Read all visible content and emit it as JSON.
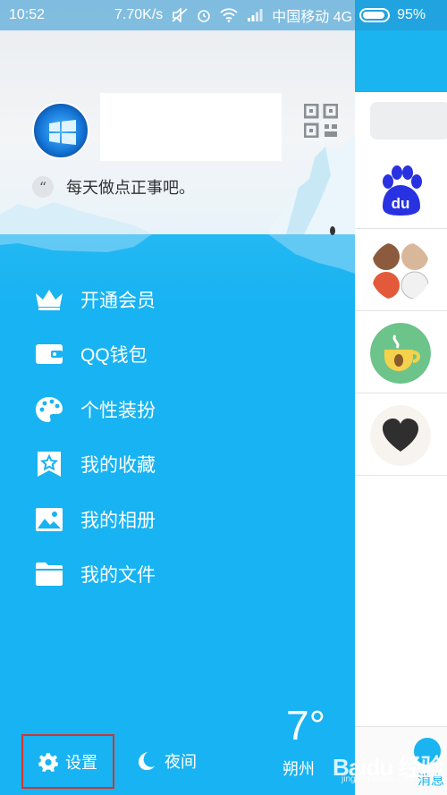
{
  "status_bar": {
    "time": "10:52",
    "speed": "7.70K/s",
    "carrier": "中国移动 4G",
    "battery": "95%"
  },
  "profile": {
    "avatar_icon": "windows-logo",
    "signature_badge": "“",
    "signature": "每天做点正事吧。"
  },
  "menu": {
    "items": [
      {
        "label": "开通会员",
        "icon": "crown-icon"
      },
      {
        "label": "QQ钱包",
        "icon": "wallet-icon"
      },
      {
        "label": "个性装扮",
        "icon": "palette-icon"
      },
      {
        "label": "我的收藏",
        "icon": "bookmark-star-icon"
      },
      {
        "label": "我的相册",
        "icon": "photo-icon"
      },
      {
        "label": "我的文件",
        "icon": "folder-icon"
      }
    ]
  },
  "bottom": {
    "settings_label": "设置",
    "night_label": "夜间",
    "weather_temp": "7°",
    "weather_city": "朔州"
  },
  "right_panel": {
    "message_tab_label": "消息"
  },
  "watermark": {
    "text": "Baidu 经验",
    "sub": "jingyan.baidu.com"
  },
  "colors": {
    "drawer_blue": "#18b3f2",
    "highlight_red": "#d2342f"
  }
}
